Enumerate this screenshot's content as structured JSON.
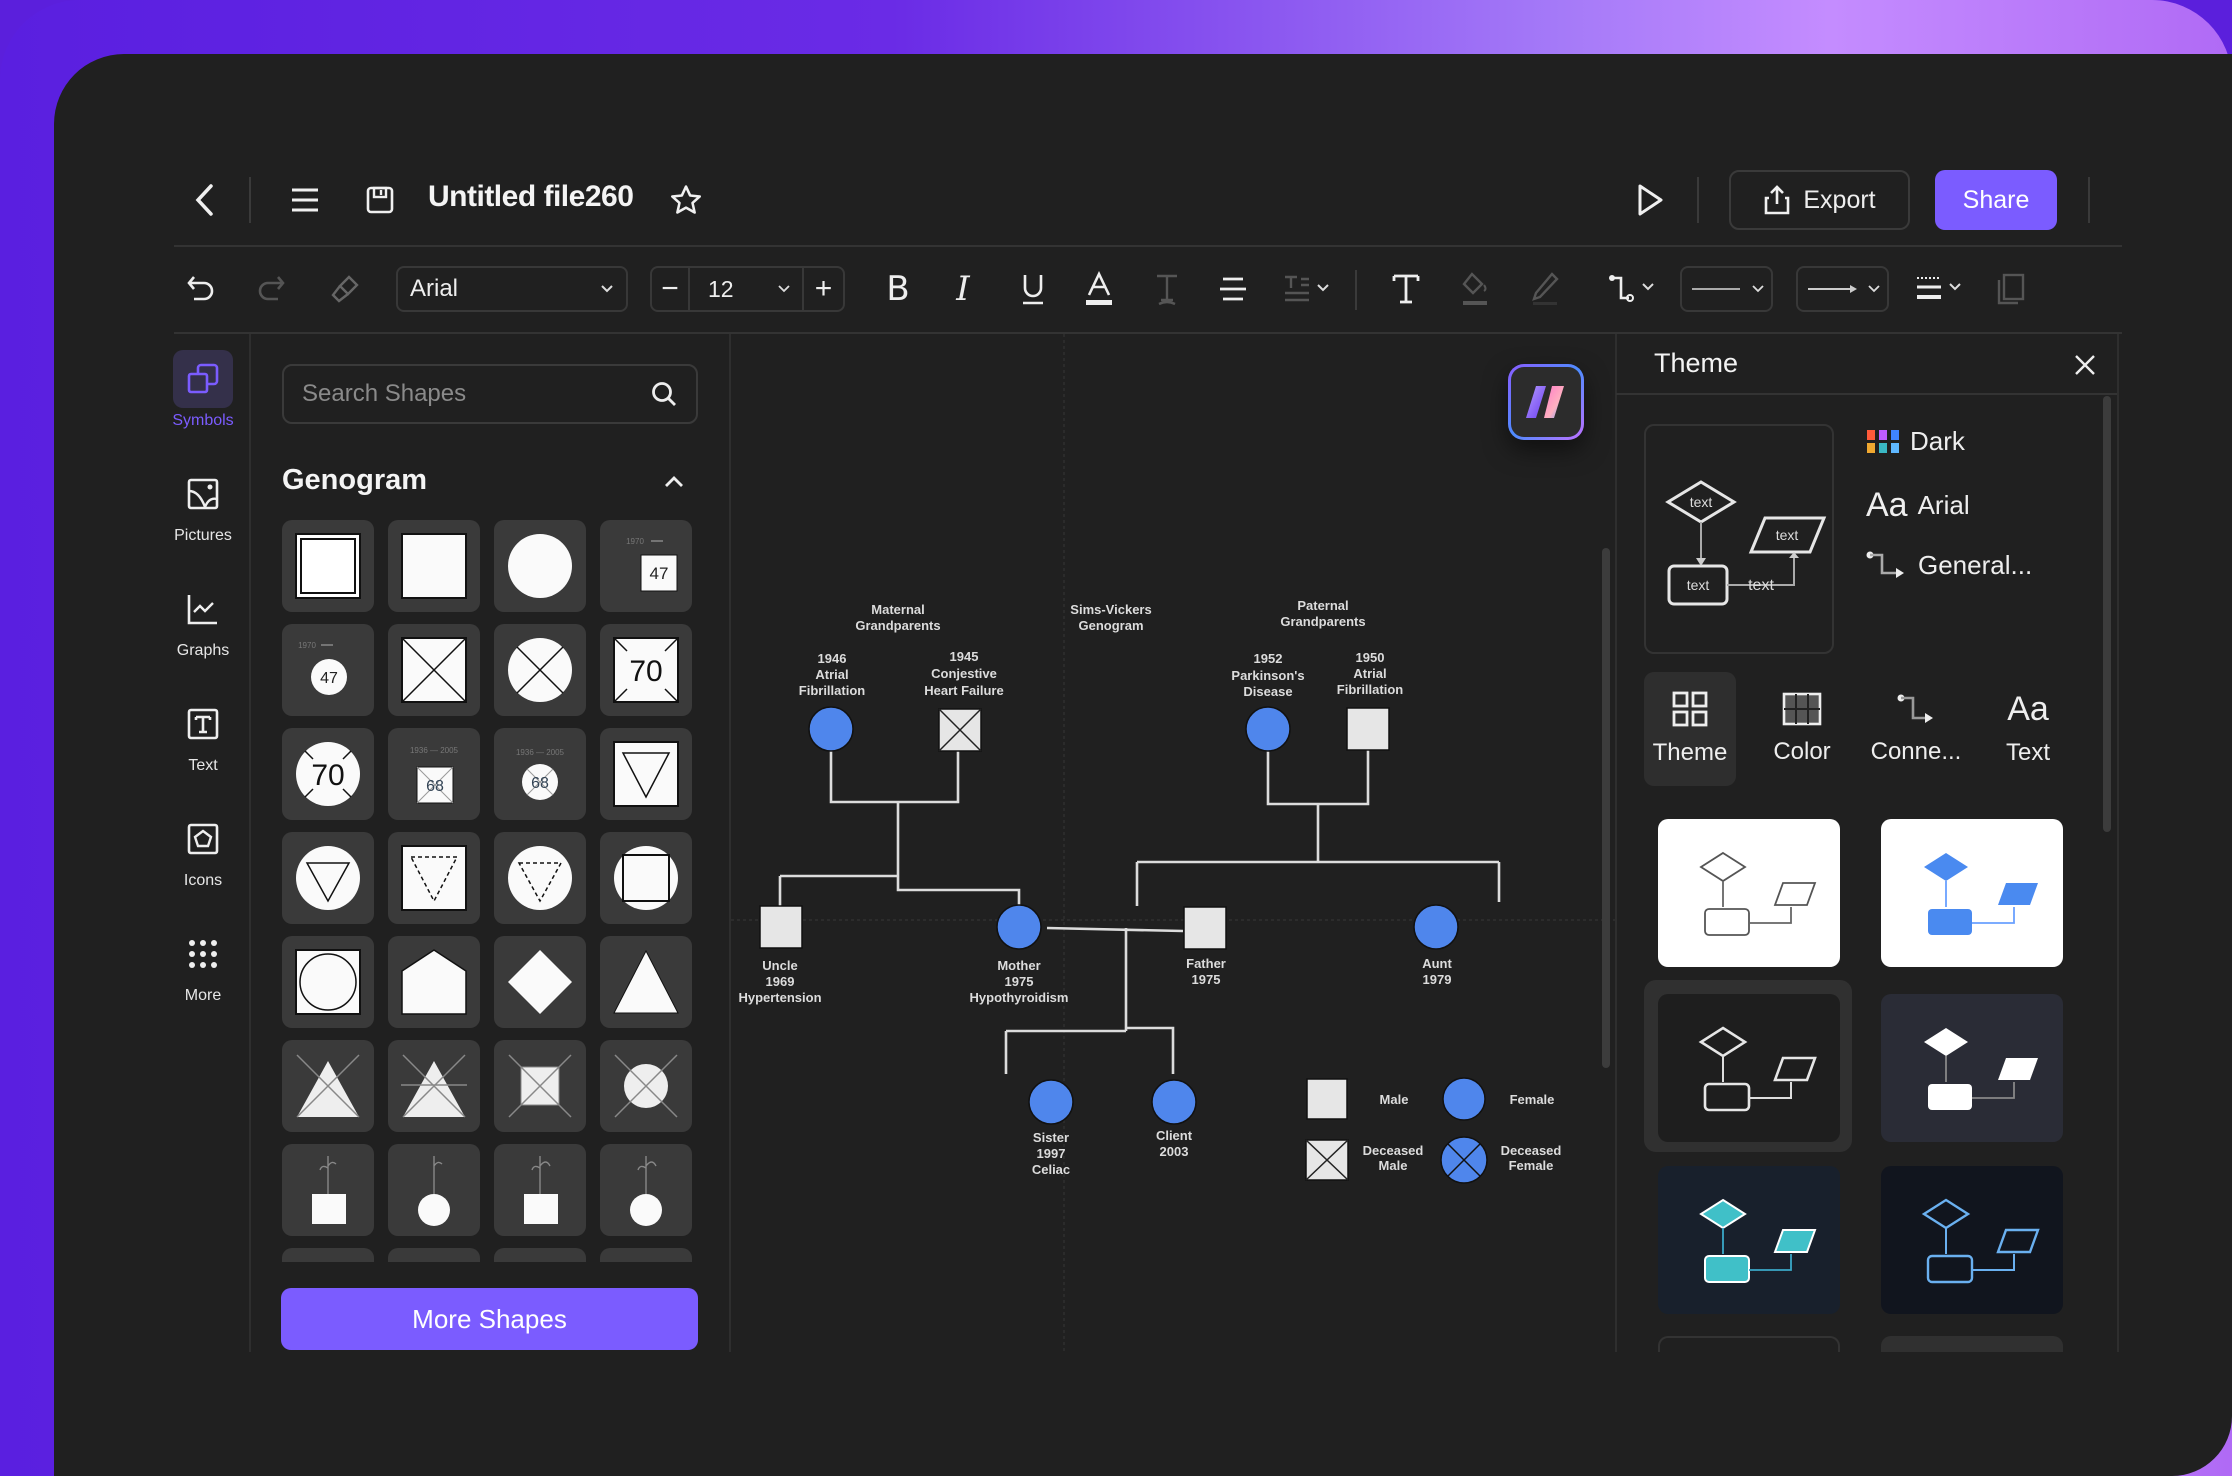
{
  "header": {
    "title": "Untitled file260",
    "export_label": "Export",
    "share_label": "Share"
  },
  "toolbar": {
    "font_family": "Arial",
    "font_size": "12",
    "minus": "−",
    "plus": "+"
  },
  "rail": {
    "items": [
      {
        "label": "Symbols",
        "icon": "symbols-icon",
        "active": true
      },
      {
        "label": "Pictures",
        "icon": "picture-icon"
      },
      {
        "label": "Graphs",
        "icon": "graph-icon"
      },
      {
        "label": "Text",
        "icon": "text-icon"
      },
      {
        "label": "Icons",
        "icon": "icons-icon"
      },
      {
        "label": "More",
        "icon": "more-grid-icon"
      }
    ]
  },
  "shapes": {
    "search_placeholder": "Search Shapes",
    "category": "Genogram",
    "more_button": "More Shapes",
    "cell_labels": {
      "47": "47",
      "70": "70",
      "68": "68"
    }
  },
  "genogram": {
    "title_line1": "Sims-Vickers",
    "title_line2": "Genogram",
    "maternal_label": [
      "Maternal",
      "Grandparents"
    ],
    "paternal_label": [
      "Paternal",
      "Grandparents"
    ],
    "people": {
      "maternal_gm": [
        "1946",
        "Atrial",
        "Fibrillation"
      ],
      "maternal_gf": [
        "1945",
        "Conjestive",
        "Heart Failure"
      ],
      "paternal_gm": [
        "1952",
        "Parkinson's",
        "Disease"
      ],
      "paternal_gf": [
        "1950",
        "Atrial",
        "Fibrillation"
      ],
      "uncle": [
        "Uncle",
        "1969",
        "Hypertension"
      ],
      "mother": [
        "Mother",
        "1975",
        "Hypothyroidism"
      ],
      "father": [
        "Father",
        "1975"
      ],
      "aunt": [
        "Aunt",
        "1979"
      ],
      "sister": [
        "Sister",
        "1997",
        "Celiac"
      ],
      "client": [
        "Client",
        "2003"
      ]
    },
    "legend": {
      "male": "Male",
      "female": "Female",
      "deceased_male": [
        "Deceased",
        "Male"
      ],
      "deceased_female": [
        "Deceased",
        "Female"
      ]
    },
    "colors": {
      "female": "#4f86ec",
      "male": "#e6e6e6",
      "line": "#e0e0e0"
    }
  },
  "theme_panel": {
    "title": "Theme",
    "preview_text": "text",
    "color_scheme": "Dark",
    "font": "Arial",
    "connector": "General...",
    "tabs": [
      {
        "label": "Theme",
        "active": true
      },
      {
        "label": "Color"
      },
      {
        "label": "Conne..."
      },
      {
        "label": "Text"
      }
    ]
  },
  "colors": {
    "accent": "#7b5cff",
    "background": "#202020"
  }
}
